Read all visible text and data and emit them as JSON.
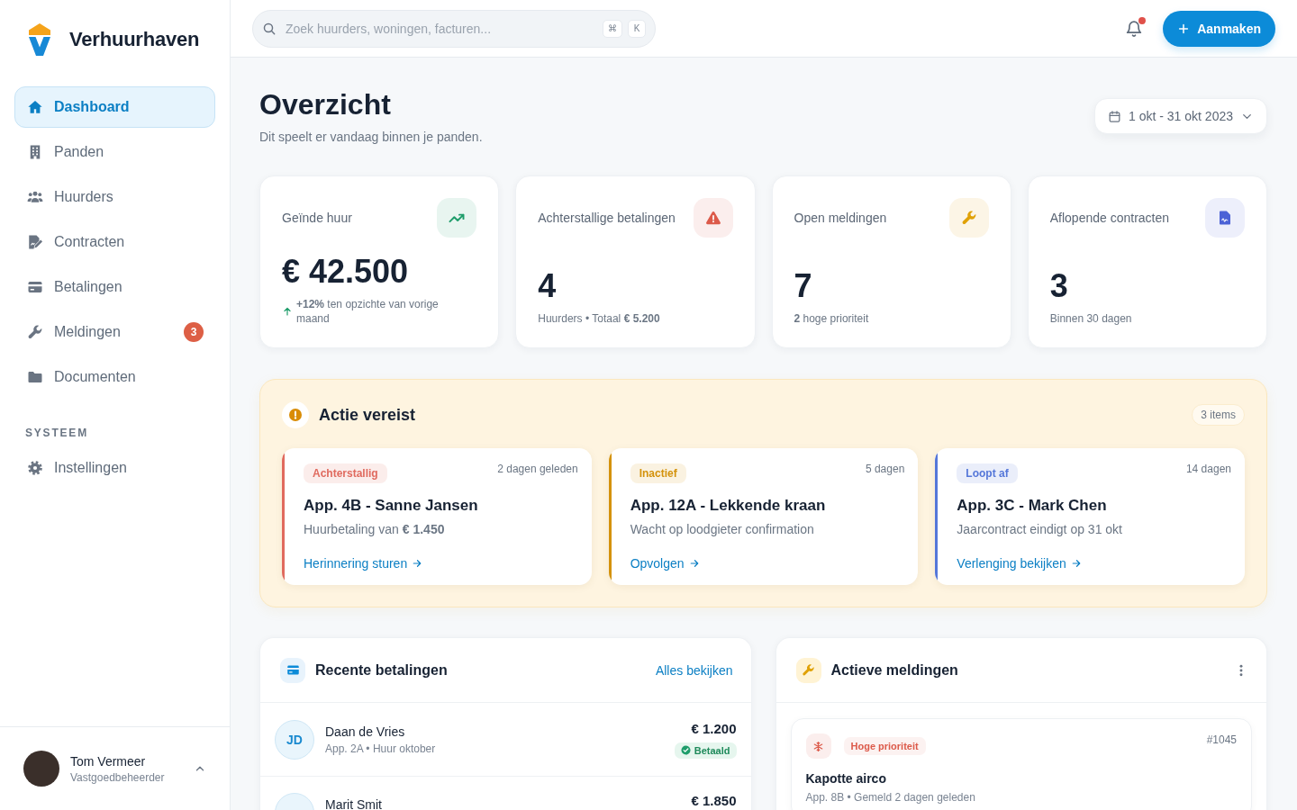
{
  "sidebar": {
    "brand": "Verhuurhaven",
    "items": [
      {
        "label": "Dashboard",
        "selected": true
      },
      {
        "label": "Panden",
        "selected": false
      },
      {
        "label": "Huurders",
        "selected": false
      },
      {
        "label": "Contracten",
        "selected": false
      },
      {
        "label": "Betalingen",
        "selected": false
      },
      {
        "label": "Meldingen",
        "selected": false,
        "badge": "3"
      },
      {
        "label": "Documenten",
        "selected": false
      }
    ],
    "sections": [
      {
        "title": "SYSTEEM",
        "items": [
          {
            "label": "Instellingen",
            "selected": false
          }
        ]
      }
    ],
    "user": {
      "name": "Tom Vermeer",
      "role": "Vastgoedbeheerder"
    }
  },
  "topbar": {
    "search": {
      "placeholder": "Zoek huurders, woningen, facturen...",
      "shortcut": [
        "⌘",
        "K"
      ]
    },
    "notifications": {
      "unread": true
    },
    "create_button": "Aanmaken"
  },
  "header": {
    "title": "Overzicht",
    "subtitle": "Dit speelt er vandaag binnen je panden.",
    "date_range": "1 okt - 31 okt 2023"
  },
  "stats": [
    {
      "kind": "growth",
      "label": "Geïnde huur",
      "value": "€ 42.500",
      "note": "**+12%** ten opzichte van vorige maand",
      "color": "#1f9d6b"
    },
    {
      "kind": "warning",
      "label": "Achterstallige betalingen",
      "value": "4",
      "note": "Huurders • Totaal **€ 5.200**",
      "color": "#dc5a4a"
    },
    {
      "kind": "warning",
      "label": "Open meldingen",
      "value": "7",
      "note": "**2** hoge prioriteit",
      "color": "#e0a106"
    },
    {
      "kind": "plain",
      "label": "Aflopende contracten",
      "value": "3",
      "note": "Binnen 30 dagen",
      "color": "#4b62d6"
    }
  ],
  "action_required": {
    "title": "Actie vereist",
    "count": "3 items",
    "items": [
      {
        "tag": "Achterstallig",
        "time": "2 dagen geleden",
        "title": "App. 4B - Sanne Jansen",
        "description": "Huurbetaling van **€ 1.450**",
        "link": "Herinnering sturen",
        "color": "#e06a5e"
      },
      {
        "tag": "Inactief",
        "time": "5 dagen",
        "title": "App. 12A - Lekkende kraan",
        "description": "Wacht op loodgieter confirmation",
        "link": "Opvolgen",
        "color": "#d4920b"
      },
      {
        "tag": "Loopt af",
        "time": "14 dagen",
        "title": "App. 3C - Mark Chen",
        "description": "Jaarcontract eindigt op 31 okt",
        "link": "Verlenging bekijken",
        "color": "#5577d9"
      }
    ]
  },
  "recent_payments": {
    "title": "Recente betalingen",
    "link": "Alles bekijken",
    "rows": [
      {
        "initials": "JD",
        "name": "Daan de Vries",
        "details": "App. 2A • Huur oktober",
        "amount": "€ 1.200",
        "status": "Betaald"
      },
      {
        "name": "Marit Smit",
        "amount": "€ 1.850"
      }
    ]
  },
  "active_reports": {
    "title": "Actieve meldingen",
    "items": [
      {
        "priority": "Hoge prioriteit",
        "number": "#1045",
        "title": "Kapotte airco",
        "details": "App. 8B • Gemeld 2 dagen geleden",
        "color": "#dc5a4a"
      }
    ]
  }
}
